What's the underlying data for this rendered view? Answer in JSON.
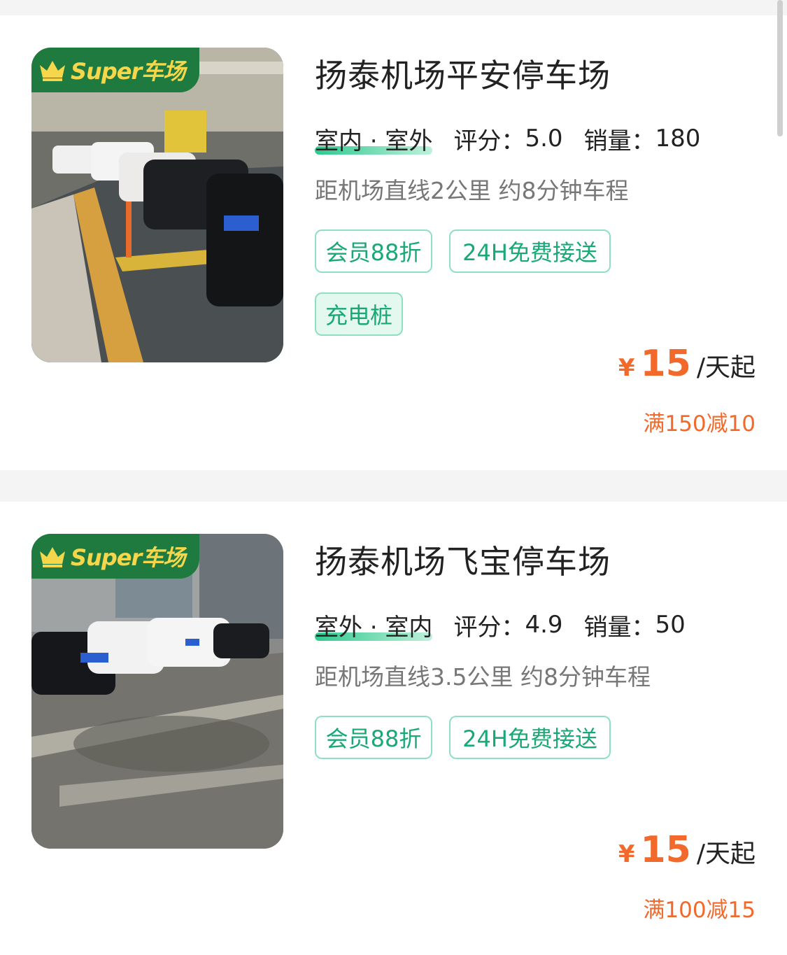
{
  "listings": [
    {
      "badge_text": "Super车场",
      "title": "扬泰机场平安停车场",
      "type": "室内 · 室外",
      "rating_label": "评分：",
      "rating": "5.0",
      "sales_label": "销量：",
      "sales": "180",
      "distance": "距机场直线2公里 约8分钟车程",
      "tags": [
        "会员88折",
        "24H免费接送",
        "充电桩"
      ],
      "price_symbol": "¥",
      "price": "15",
      "price_unit": "/天起",
      "discount": "满150减10"
    },
    {
      "badge_text": "Super车场",
      "title": "扬泰机场飞宝停车场",
      "type": "室外 · 室内",
      "rating_label": "评分：",
      "rating": "4.9",
      "sales_label": "销量：",
      "sales": "50",
      "distance": "距机场直线3.5公里 约8分钟车程",
      "tags": [
        "会员88折",
        "24H免费接送"
      ],
      "price_symbol": "¥",
      "price": "15",
      "price_unit": "/天起",
      "discount": "满100减15"
    }
  ],
  "colors": {
    "accent_price": "#f26a2b",
    "tag_green": "#1aa876",
    "badge_green": "#1e7a3e",
    "badge_gold": "#f6d64a"
  },
  "icons": {
    "badge": "crown-icon"
  }
}
